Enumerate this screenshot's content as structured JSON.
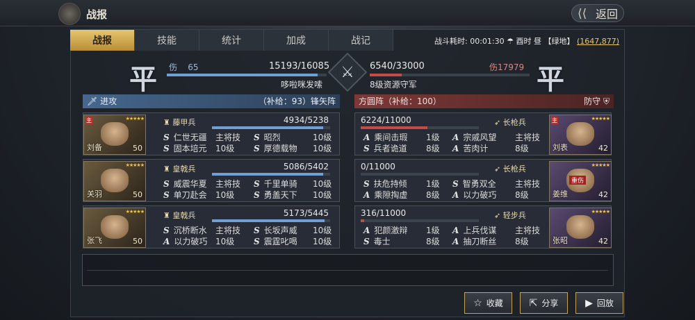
{
  "header": {
    "title": "战报",
    "back_label": "返回"
  },
  "tabs": [
    {
      "label": "战报",
      "active": true
    },
    {
      "label": "技能"
    },
    {
      "label": "统计"
    },
    {
      "label": "加成"
    },
    {
      "label": "战记"
    }
  ],
  "battle_info": {
    "duration_label": "战斗耗时:",
    "duration": "00:01:30",
    "weather": "☂",
    "time": "酉时 昼",
    "terrain": "【绿地】",
    "coord": "(1647,877)"
  },
  "result": {
    "left_seal": "平",
    "right_seal": "平"
  },
  "left": {
    "loss_label": "伤",
    "loss": "65",
    "hp": "15193/16085",
    "hp_fraction": 0.945,
    "commander": "哆啦咪发嗦",
    "side_label": "进攻",
    "supply": "（补给：93）",
    "formation": "锋矢阵",
    "generals": [
      {
        "name": "刘备",
        "level": "50",
        "main": "主",
        "troop": "藤甲兵",
        "hp": "4934/5238",
        "hp_fraction": 0.94,
        "skills": [
          {
            "type": "S",
            "name": "仁世无疆",
            "level": "主将技"
          },
          {
            "type": "S",
            "name": "昭烈",
            "level": "10级"
          },
          {
            "type": "S",
            "name": "固本培元",
            "level": "10级"
          },
          {
            "type": "S",
            "name": "厚德载物",
            "level": "10级"
          }
        ]
      },
      {
        "name": "关羽",
        "level": "50",
        "troop": "皇戟兵",
        "hp": "5086/5402",
        "hp_fraction": 0.94,
        "skills": [
          {
            "type": "S",
            "name": "威震华夏",
            "level": "主将技"
          },
          {
            "type": "S",
            "name": "千里单骑",
            "level": "10级"
          },
          {
            "type": "S",
            "name": "单刀赴会",
            "level": "10级"
          },
          {
            "type": "S",
            "name": "勇盖天下",
            "level": "10级"
          }
        ]
      },
      {
        "name": "张飞",
        "level": "50",
        "troop": "皇戟兵",
        "hp": "5173/5445",
        "hp_fraction": 0.95,
        "skills": [
          {
            "type": "S",
            "name": "沉桥断水",
            "level": "主将技"
          },
          {
            "type": "S",
            "name": "长坂声威",
            "level": "10级"
          },
          {
            "type": "A",
            "name": "以力破巧",
            "level": "10级"
          },
          {
            "type": "S",
            "name": "震霆叱喝",
            "level": "10级"
          }
        ]
      }
    ]
  },
  "right": {
    "loss_label": "伤",
    "loss": "17979",
    "hp": "6540/33000",
    "hp_fraction": 0.198,
    "commander": "8级资源守军",
    "side_label": "防守",
    "formation": "方圆阵",
    "supply": "（补给：100）",
    "generals": [
      {
        "name": "刘表",
        "level": "42",
        "main": "主",
        "troop": "长枪兵",
        "hp": "6224/11000",
        "hp_fraction": 0.566,
        "skills": [
          {
            "type": "A",
            "name": "乘间击瑕",
            "level": "1级"
          },
          {
            "type": "A",
            "name": "宗戚风望",
            "level": "主将技"
          },
          {
            "type": "S",
            "name": "兵者诡道",
            "level": "8级"
          },
          {
            "type": "A",
            "name": "苦肉计",
            "level": "8级"
          }
        ]
      },
      {
        "name": "姜维",
        "level": "42",
        "injured": "重伤",
        "troop": "长枪兵",
        "hp": "0/11000",
        "hp_fraction": 0,
        "skills": [
          {
            "type": "S",
            "name": "扶危持倾",
            "level": "1级"
          },
          {
            "type": "S",
            "name": "智勇双全",
            "level": "主将技"
          },
          {
            "type": "A",
            "name": "乘隙掏虚",
            "level": "8级"
          },
          {
            "type": "A",
            "name": "以力破巧",
            "level": "8级"
          }
        ]
      },
      {
        "name": "张昭",
        "level": "42",
        "troop": "轻步兵",
        "hp": "316/11000",
        "hp_fraction": 0.029,
        "skills": [
          {
            "type": "A",
            "name": "犯颜激辩",
            "level": "1级"
          },
          {
            "type": "A",
            "name": "上兵伐谋",
            "level": "主将技"
          },
          {
            "type": "S",
            "name": "毒士",
            "level": "8级"
          },
          {
            "type": "A",
            "name": "抽刀断丝",
            "level": "8级"
          }
        ]
      }
    ]
  },
  "buttons": {
    "collect": "收藏",
    "share": "分享",
    "replay": "回放"
  },
  "colors": {
    "gold_tab": "#e7c670",
    "attack_bar": "#6f9fd3",
    "defend_bar": "#c44b47"
  }
}
